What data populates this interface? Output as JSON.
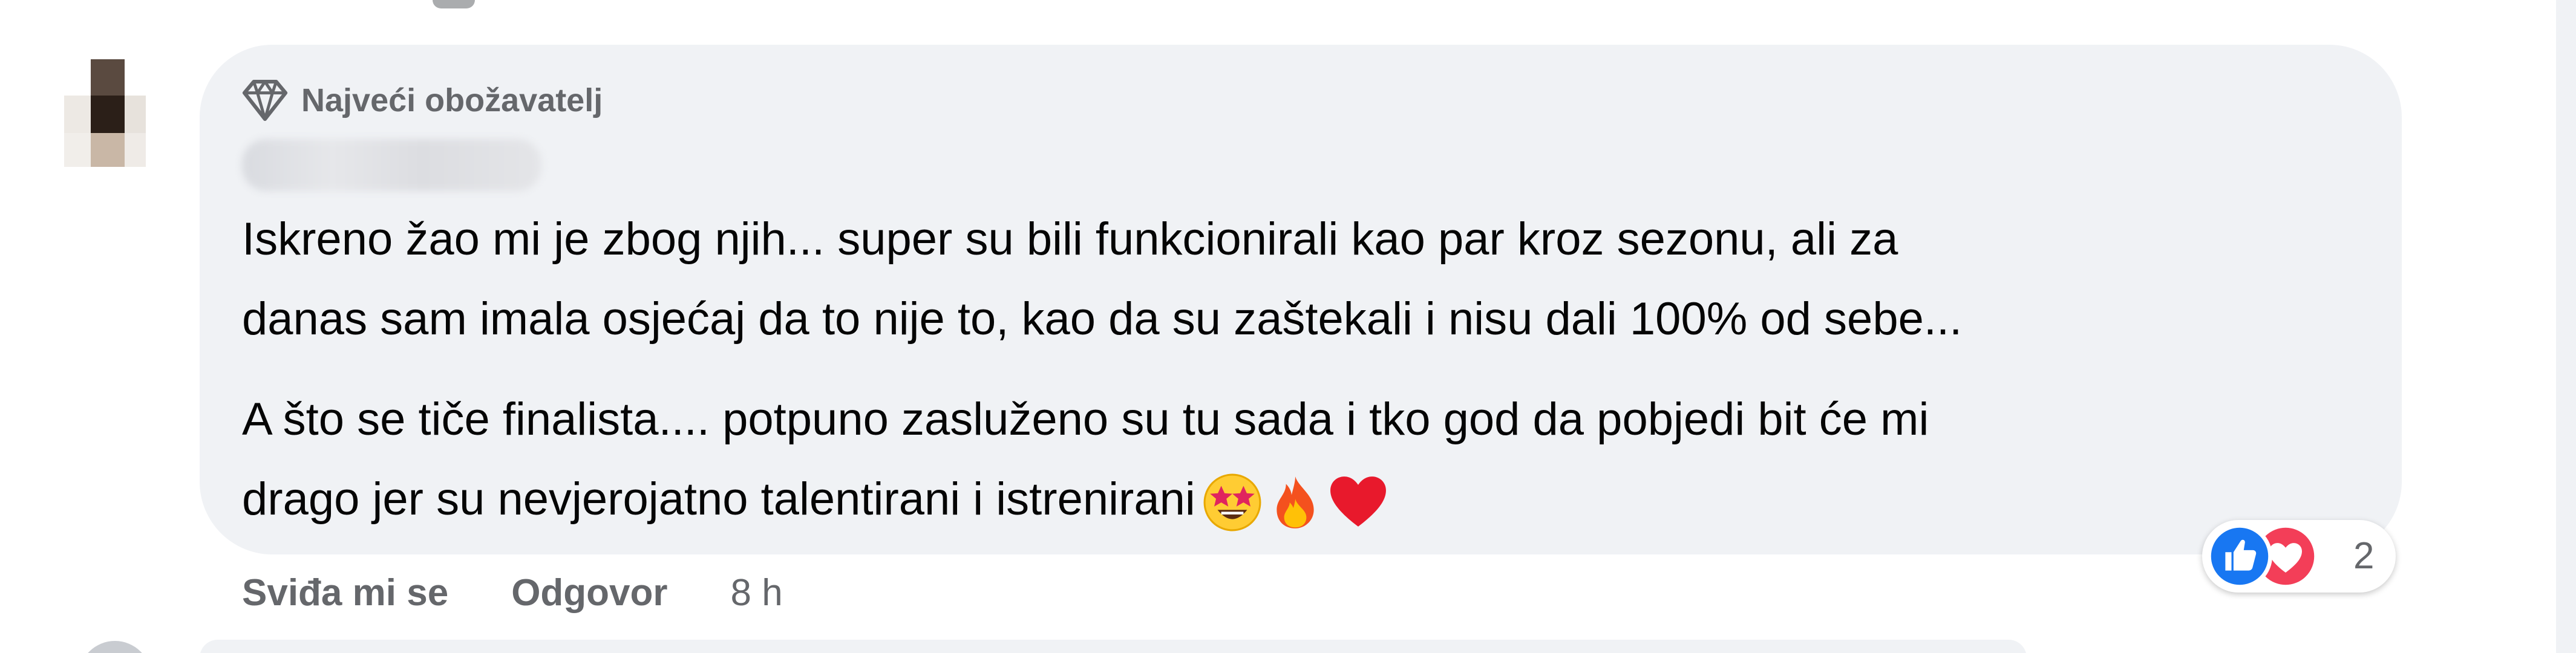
{
  "comment": {
    "badge_label": "Najveći obožavatelj",
    "badge_icon": "diamond-icon",
    "author_name_blurred": true,
    "paragraphs": [
      "Iskreno žao mi je zbog njih... super su bili funkcionirali kao par kroz sezonu, ali za\ndanas sam imala osjećaj da to nije to, kao da su zaštekali i nisu dali 100% od sebe...",
      "A što se tiče finalista.... potpuno zasluženo su tu sada i tko god da pobjedi bit će mi\ndrago jer su nevjerojatno talentirani i istrenirani"
    ],
    "emojis": [
      "star-struck-emoji",
      "fire-emoji",
      "red-heart-emoji"
    ],
    "actions": {
      "like_label": "Sviđa mi se",
      "reply_label": "Odgovor",
      "timestamp": "8 h"
    },
    "reactions": {
      "icons": [
        "like-icon",
        "love-icon"
      ],
      "count": "2"
    }
  },
  "colors": {
    "bubble_bg": "#f0f2f5",
    "text_primary": "#050505",
    "text_secondary": "#65676b",
    "like_blue": "#1877f2",
    "love_red": "#f33e58"
  }
}
